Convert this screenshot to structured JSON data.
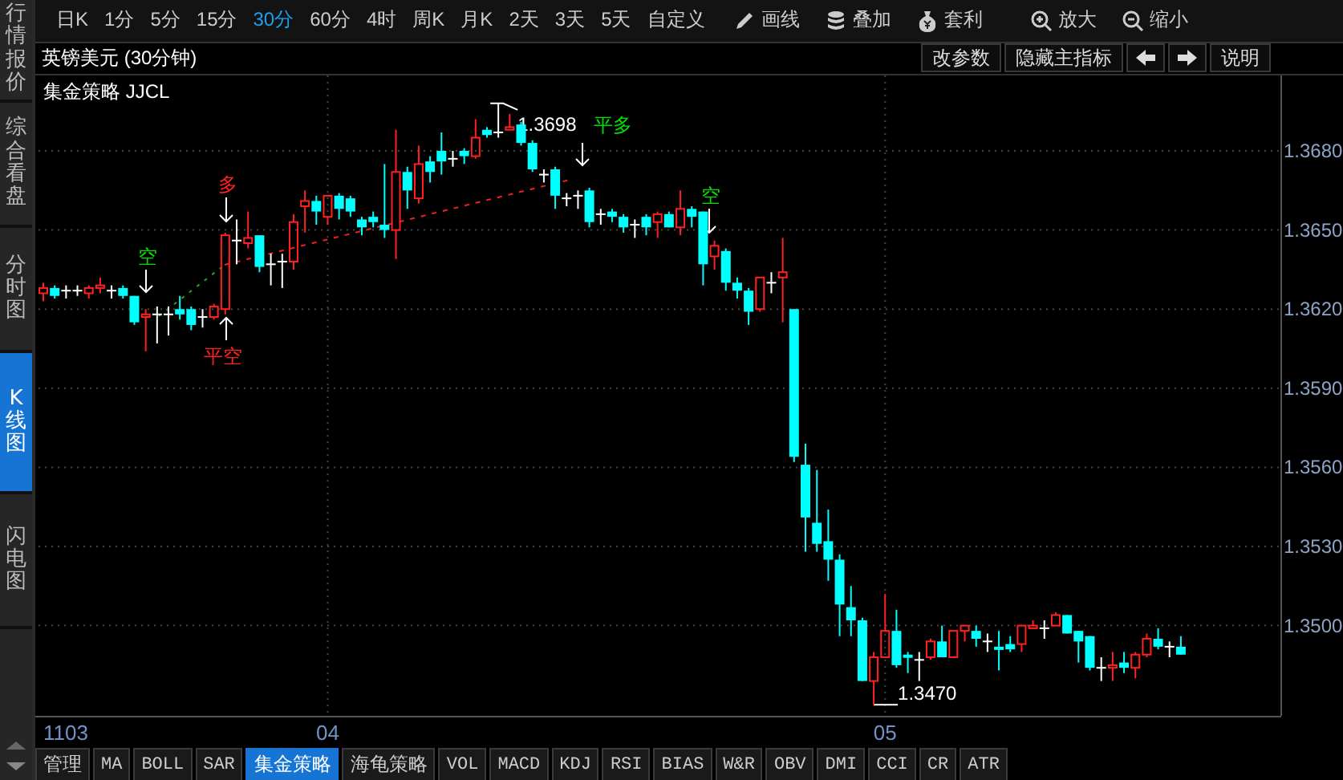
{
  "sidebar": {
    "tabs": [
      {
        "label": "行情报价",
        "selected": false
      },
      {
        "label": "综合看盘",
        "selected": false
      },
      {
        "label": "分时图",
        "selected": false
      },
      {
        "label": "K线图",
        "selected": true
      },
      {
        "label": "闪电图",
        "selected": false
      }
    ]
  },
  "toolbar": {
    "periods": [
      {
        "label": "日K",
        "selected": false
      },
      {
        "label": "1分",
        "selected": false
      },
      {
        "label": "5分",
        "selected": false
      },
      {
        "label": "15分",
        "selected": false
      },
      {
        "label": "30分",
        "selected": true
      },
      {
        "label": "60分",
        "selected": false
      },
      {
        "label": "4时",
        "selected": false
      },
      {
        "label": "周K",
        "selected": false
      },
      {
        "label": "月K",
        "selected": false
      },
      {
        "label": "2天",
        "selected": false
      },
      {
        "label": "3天",
        "selected": false
      },
      {
        "label": "5天",
        "selected": false
      },
      {
        "label": "自定义",
        "selected": false
      }
    ],
    "tools": [
      "画线",
      "叠加",
      "套利",
      "放大",
      "缩小"
    ]
  },
  "chart_header": {
    "title": "英镑美元 (30分钟)",
    "buttons": [
      {
        "kind": "text",
        "label": "改参数"
      },
      {
        "kind": "text",
        "label": "隐藏主指标"
      },
      {
        "kind": "arrow-left"
      },
      {
        "kind": "arrow-right"
      },
      {
        "kind": "text",
        "label": "说明"
      }
    ]
  },
  "chart": {
    "indicator_label": "集金策略 JJCL",
    "start_date": "1103",
    "chart_data": {
      "type": "candlestick",
      "grid": true,
      "ylim": [
        1.34658,
        1.37086
      ],
      "xlim": [
        3.4754,
        5.7092
      ],
      "xticks": [
        {
          "value": 4,
          "label": "04"
        },
        {
          "value": 5,
          "label": "05"
        }
      ],
      "x": [
        3.4898,
        3.5102,
        3.5306,
        3.551,
        3.5714,
        3.5918,
        3.6122,
        3.6327,
        3.6531,
        3.6735,
        3.6939,
        3.7143,
        3.7347,
        3.7551,
        3.7755,
        3.7959,
        3.8163,
        3.8367,
        3.8571,
        3.8776,
        3.898,
        3.9184,
        3.9388,
        3.9592,
        3.9796,
        4.0,
        4.0204,
        4.0408,
        4.0612,
        4.0816,
        4.102,
        4.1224,
        4.1429,
        4.1633,
        4.1837,
        4.2041,
        4.2245,
        4.2449,
        4.2653,
        4.2857,
        4.3061,
        4.3265,
        4.3469,
        4.3673,
        4.3878,
        4.4082,
        4.4286,
        4.449,
        4.4694,
        4.4898,
        4.5102,
        4.5306,
        4.551,
        4.5714,
        4.5918,
        4.6122,
        4.6327,
        4.6531,
        4.6735,
        4.6939,
        4.7143,
        4.7347,
        4.7551,
        4.7755,
        4.7959,
        4.8163,
        4.8367,
        4.8571,
        4.8776,
        4.898,
        4.9184,
        4.9388,
        4.9592,
        4.9796,
        5.0,
        5.0204,
        5.0408,
        5.0612,
        5.0816,
        5.102,
        5.1224,
        5.1429,
        5.1633,
        5.1837,
        5.2041,
        5.2245,
        5.2449,
        5.2653,
        5.2857,
        5.3061,
        5.3265,
        5.3469,
        5.3673,
        5.3878,
        5.4082,
        5.4286,
        5.449,
        5.4694,
        5.4898,
        5.5102,
        5.5306
      ],
      "yticks": [
        {
          "value": 1.368,
          "label": "1.3680"
        },
        {
          "value": 1.365,
          "label": "1.3650"
        },
        {
          "value": 1.362,
          "label": "1.3620"
        },
        {
          "value": 1.359,
          "label": "1.3590"
        },
        {
          "value": 1.356,
          "label": "1.3560"
        },
        {
          "value": 1.353,
          "label": "1.3530"
        },
        {
          "value": 1.35,
          "label": "1.3500"
        }
      ],
      "ohlc": [
        [
          1.3626,
          1.363,
          1.3623,
          1.3628
        ],
        [
          1.3628,
          1.3629,
          1.3624,
          1.3625
        ],
        [
          1.3627,
          1.3629,
          1.3624,
          1.3627
        ],
        [
          1.3627,
          1.3629,
          1.3625,
          1.3627
        ],
        [
          1.3626,
          1.3629,
          1.3624,
          1.3628
        ],
        [
          1.3628,
          1.3632,
          1.3626,
          1.3629
        ],
        [
          1.3627,
          1.3629,
          1.3624,
          1.3627
        ],
        [
          1.3628,
          1.3629,
          1.3624,
          1.3625
        ],
        [
          1.3625,
          1.3625,
          1.3614,
          1.3615
        ],
        [
          1.3617,
          1.362,
          1.3604,
          1.3618
        ],
        [
          1.3618,
          1.3621,
          1.3607,
          1.3618
        ],
        [
          1.3618,
          1.3621,
          1.361,
          1.3618
        ],
        [
          1.362,
          1.3625,
          1.3616,
          1.3618
        ],
        [
          1.362,
          1.3621,
          1.3612,
          1.3614
        ],
        [
          1.3617,
          1.362,
          1.3613,
          1.3617
        ],
        [
          1.3617,
          1.3622,
          1.3616,
          1.3621
        ],
        [
          1.362,
          1.3649,
          1.3618,
          1.3648
        ],
        [
          1.3646,
          1.3654,
          1.3637,
          1.3646
        ],
        [
          1.3645,
          1.3657,
          1.3643,
          1.3647
        ],
        [
          1.3648,
          1.3648,
          1.3634,
          1.3636
        ],
        [
          1.3637,
          1.3641,
          1.3629,
          1.3637
        ],
        [
          1.3638,
          1.3641,
          1.3628,
          1.3638
        ],
        [
          1.3638,
          1.3656,
          1.3635,
          1.3653
        ],
        [
          1.3659,
          1.3665,
          1.3649,
          1.3661
        ],
        [
          1.3661,
          1.3663,
          1.3652,
          1.3657
        ],
        [
          1.3655,
          1.3663,
          1.3652,
          1.3663
        ],
        [
          1.3663,
          1.3664,
          1.3654,
          1.3658
        ],
        [
          1.3662,
          1.3663,
          1.3655,
          1.3657
        ],
        [
          1.3654,
          1.3655,
          1.3648,
          1.3651
        ],
        [
          1.3655,
          1.3657,
          1.3651,
          1.3653
        ],
        [
          1.3652,
          1.3675,
          1.3647,
          1.365
        ],
        [
          1.365,
          1.3688,
          1.3639,
          1.3672
        ],
        [
          1.3672,
          1.3674,
          1.3658,
          1.3665
        ],
        [
          1.3662,
          1.3682,
          1.366,
          1.3675
        ],
        [
          1.3676,
          1.3678,
          1.3668,
          1.3672
        ],
        [
          1.368,
          1.3687,
          1.3671,
          1.3676
        ],
        [
          1.3677,
          1.368,
          1.3674,
          1.3677
        ],
        [
          1.368,
          1.3681,
          1.3675,
          1.3678
        ],
        [
          1.3678,
          1.3692,
          1.3677,
          1.3685
        ],
        [
          1.3688,
          1.3689,
          1.3685,
          1.3686
        ],
        [
          1.3687,
          1.3698,
          1.3685,
          1.3687
        ],
        [
          1.3688,
          1.3694,
          1.3688,
          1.3689
        ],
        [
          1.369,
          1.3691,
          1.3682,
          1.3683
        ],
        [
          1.3683,
          1.3684,
          1.3672,
          1.3673
        ],
        [
          1.3671,
          1.3673,
          1.3668,
          1.3671
        ],
        [
          1.3673,
          1.3674,
          1.3658,
          1.3663
        ],
        [
          1.3662,
          1.3664,
          1.3659,
          1.3662
        ],
        [
          1.3663,
          1.3665,
          1.3658,
          1.3663
        ],
        [
          1.3665,
          1.3666,
          1.3651,
          1.3653
        ],
        [
          1.3656,
          1.3658,
          1.3652,
          1.3656
        ],
        [
          1.3657,
          1.3658,
          1.3653,
          1.3655
        ],
        [
          1.3655,
          1.3656,
          1.3649,
          1.3651
        ],
        [
          1.3652,
          1.3654,
          1.3647,
          1.3652
        ],
        [
          1.3655,
          1.3656,
          1.3648,
          1.3651
        ],
        [
          1.3653,
          1.3657,
          1.3647,
          1.3656
        ],
        [
          1.3656,
          1.3657,
          1.3651,
          1.3651
        ],
        [
          1.3651,
          1.3665,
          1.3648,
          1.3658
        ],
        [
          1.3658,
          1.3659,
          1.3651,
          1.3655
        ],
        [
          1.3657,
          1.3657,
          1.3629,
          1.3637
        ],
        [
          1.364,
          1.3646,
          1.3635,
          1.3644
        ],
        [
          1.3642,
          1.3643,
          1.3627,
          1.363
        ],
        [
          1.363,
          1.3632,
          1.3624,
          1.3627
        ],
        [
          1.3627,
          1.3628,
          1.3614,
          1.3619
        ],
        [
          1.362,
          1.3632,
          1.3619,
          1.3632
        ],
        [
          1.363,
          1.3634,
          1.3626,
          1.363
        ],
        [
          1.3632,
          1.3647,
          1.3615,
          1.3634
        ],
        [
          1.362,
          1.362,
          1.3562,
          1.3564
        ],
        [
          1.3561,
          1.3569,
          1.3528,
          1.3541
        ],
        [
          1.3539,
          1.3559,
          1.3528,
          1.3531
        ],
        [
          1.3532,
          1.3544,
          1.3517,
          1.3525
        ],
        [
          1.3525,
          1.3527,
          1.3496,
          1.3508
        ],
        [
          1.3507,
          1.3515,
          1.3496,
          1.3502
        ],
        [
          1.3502,
          1.3503,
          1.3479,
          1.3479
        ],
        [
          1.3479,
          1.349,
          1.347,
          1.3488
        ],
        [
          1.3488,
          1.3512,
          1.3488,
          1.3498
        ],
        [
          1.3498,
          1.3506,
          1.3484,
          1.3485
        ],
        [
          1.3489,
          1.349,
          1.3482,
          1.3488
        ],
        [
          1.3487,
          1.349,
          1.3479,
          1.3487
        ],
        [
          1.3488,
          1.3495,
          1.3487,
          1.3494
        ],
        [
          1.3494,
          1.35,
          1.3488,
          1.3488
        ],
        [
          1.3488,
          1.3498,
          1.3488,
          1.3498
        ],
        [
          1.3498,
          1.35,
          1.3494,
          1.35
        ],
        [
          1.3498,
          1.35,
          1.3492,
          1.3495
        ],
        [
          1.3494,
          1.3497,
          1.349,
          1.3494
        ],
        [
          1.3492,
          1.3498,
          1.3483,
          1.3491
        ],
        [
          1.3493,
          1.3496,
          1.349,
          1.3491
        ],
        [
          1.3493,
          1.35,
          1.349,
          1.35
        ],
        [
          1.3499,
          1.3502,
          1.3499,
          1.35
        ],
        [
          1.3499,
          1.3502,
          1.3495,
          1.3499
        ],
        [
          1.35,
          1.3505,
          1.35,
          1.3504
        ],
        [
          1.3504,
          1.3504,
          1.3497,
          1.3497
        ],
        [
          1.3498,
          1.3498,
          1.3486,
          1.3494
        ],
        [
          1.3496,
          1.3496,
          1.3483,
          1.3484
        ],
        [
          1.3484,
          1.3488,
          1.3479,
          1.3484
        ],
        [
          1.3484,
          1.349,
          1.3479,
          1.3485
        ],
        [
          1.3486,
          1.349,
          1.3482,
          1.3484
        ],
        [
          1.3484,
          1.349,
          1.348,
          1.3489
        ],
        [
          1.3489,
          1.3497,
          1.3488,
          1.3495
        ],
        [
          1.3495,
          1.3499,
          1.3491,
          1.3492
        ],
        [
          1.3492,
          1.3494,
          1.3488,
          1.3492
        ],
        [
          1.3492,
          1.3496,
          1.3489,
          1.3489
        ]
      ]
    },
    "signals": [
      {
        "label": "空",
        "color": "#00e000"
      },
      {
        "label": "多",
        "color": "#ff2020"
      },
      {
        "label": "平空",
        "color": "#ff2020"
      },
      {
        "label": "平多",
        "color": "#00e000"
      },
      {
        "label": "空",
        "color": "#00e000"
      }
    ],
    "max_label": "1.3698",
    "min_label": "1.3470"
  },
  "indicator_tabs": [
    {
      "label": "管理",
      "selected": false
    },
    {
      "label": "MA",
      "selected": false
    },
    {
      "label": "BOLL",
      "selected": false
    },
    {
      "label": "SAR",
      "selected": false
    },
    {
      "label": "集金策略",
      "selected": true
    },
    {
      "label": "海龟策略",
      "selected": false
    },
    {
      "label": "VOL",
      "selected": false
    },
    {
      "label": "MACD",
      "selected": false
    },
    {
      "label": "KDJ",
      "selected": false
    },
    {
      "label": "RSI",
      "selected": false
    },
    {
      "label": "BIAS",
      "selected": false
    },
    {
      "label": "W&R",
      "selected": false
    },
    {
      "label": "OBV",
      "selected": false
    },
    {
      "label": "DMI",
      "selected": false
    },
    {
      "label": "CCI",
      "selected": false
    },
    {
      "label": "CR",
      "selected": false
    },
    {
      "label": "ATR",
      "selected": false
    }
  ]
}
